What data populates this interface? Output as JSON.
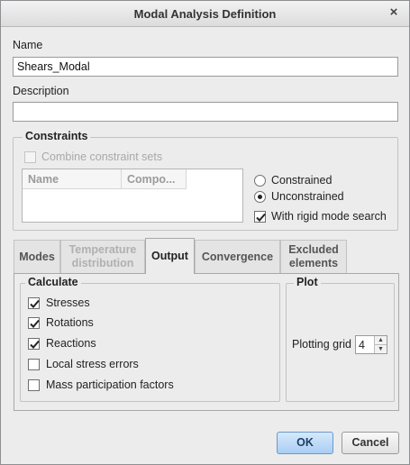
{
  "window": {
    "title": "Modal Analysis Definition"
  },
  "name": {
    "label": "Name",
    "value": "Shears_Modal"
  },
  "description": {
    "label": "Description",
    "value": ""
  },
  "constraints": {
    "title": "Constraints",
    "combine_label": "Combine constraint sets",
    "table_headers": [
      "Name",
      "Compo..."
    ],
    "radio_constrained": "Constrained",
    "radio_unconstrained": "Unconstrained",
    "rigid_mode_label": "With rigid mode search"
  },
  "tabs": [
    {
      "label": "Modes"
    },
    {
      "label": "Temperature distribution"
    },
    {
      "label": "Output"
    },
    {
      "label": "Convergence"
    },
    {
      "label": "Excluded elements"
    }
  ],
  "calculate": {
    "title": "Calculate",
    "items": [
      {
        "label": "Stresses",
        "checked": true
      },
      {
        "label": "Rotations",
        "checked": true
      },
      {
        "label": "Reactions",
        "checked": true
      },
      {
        "label": "Local stress errors",
        "checked": false
      },
      {
        "label": "Mass participation factors",
        "checked": false
      }
    ]
  },
  "plot": {
    "title": "Plot",
    "grid_label": "Plotting grid",
    "grid_value": "4"
  },
  "buttons": {
    "ok": "OK",
    "cancel": "Cancel"
  },
  "icons": {
    "close": "close-icon",
    "check": "checkmark-icon"
  }
}
